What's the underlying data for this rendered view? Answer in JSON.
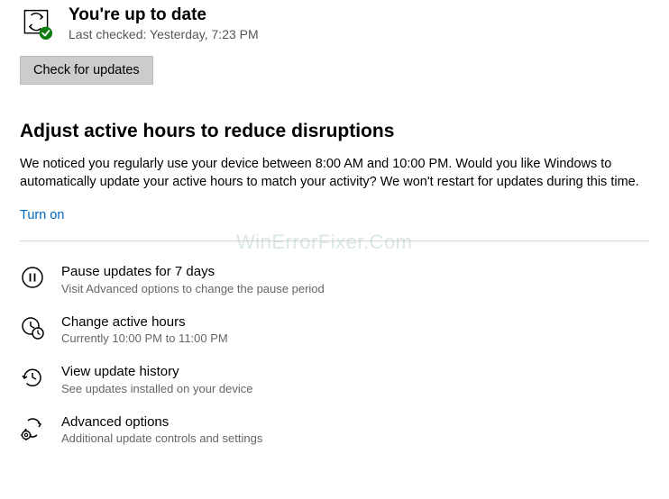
{
  "status": {
    "title": "You're up to date",
    "subtitle": "Last checked: Yesterday, 7:23 PM"
  },
  "checkButton": "Check for updates",
  "activeHours": {
    "title": "Adjust active hours to reduce disruptions",
    "body": "We noticed you regularly use your device between 8:00 AM and 10:00 PM. Would you like Windows to automatically update your active hours to match your activity? We won't restart for updates during this time.",
    "link": "Turn on"
  },
  "options": {
    "pause": {
      "title": "Pause updates for 7 days",
      "subtitle": "Visit Advanced options to change the pause period"
    },
    "changeHours": {
      "title": "Change active hours",
      "subtitle": "Currently 10:00 PM to 11:00 PM"
    },
    "history": {
      "title": "View update history",
      "subtitle": "See updates installed on your device"
    },
    "advanced": {
      "title": "Advanced options",
      "subtitle": "Additional update controls and settings"
    }
  },
  "watermark": "WinErrorFixer.Com"
}
